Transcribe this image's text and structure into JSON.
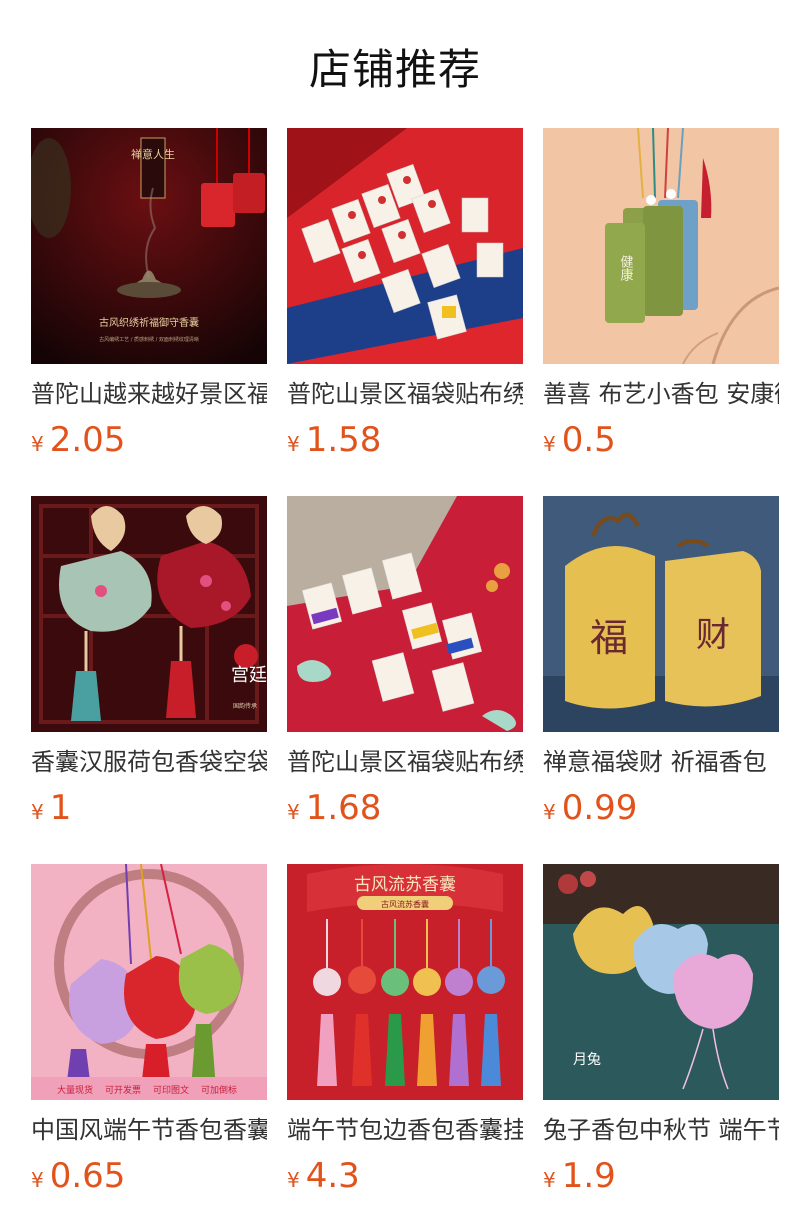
{
  "page_title": "店铺推荐",
  "products": [
    {
      "name": "普陀山越来越好景区福袋香囊祈福御守",
      "currency": "¥",
      "price": "2.05",
      "image_texts": [
        "禅意人生",
        "古风织绣祈福御守香囊",
        "古风编绣工艺 / 质感刺绣 / 双面刺绣纹理清晰"
      ]
    },
    {
      "name": "普陀山景区福袋贴布绣御守挂件",
      "currency": "¥",
      "price": "1.58",
      "image_texts": []
    },
    {
      "name": "善喜 布艺小香包 安康御守",
      "currency": "¥",
      "price": "0.5",
      "image_texts": [
        "健康"
      ]
    },
    {
      "name": "香囊汉服荷包香袋空袋挂件",
      "currency": "¥",
      "price": "1",
      "image_texts": [
        "宫廷香囊",
        "国韵传承"
      ]
    },
    {
      "name": "普陀山景区福袋贴布绣御守挂件",
      "currency": "¥",
      "price": "1.68",
      "image_texts": []
    },
    {
      "name": "禅意福袋财 祈福香包",
      "currency": "¥",
      "price": "0.99",
      "image_texts": [
        "福",
        "财"
      ]
    },
    {
      "name": "中国风端午节香包香囊挂件",
      "currency": "¥",
      "price": "0.65",
      "image_texts": [
        "大量现货",
        "可开发票",
        "可印图文",
        "可加倒标"
      ]
    },
    {
      "name": "端午节包边香包香囊挂件",
      "currency": "¥",
      "price": "4.3",
      "image_texts": [
        "古风流苏香囊",
        "古风流苏香囊"
      ]
    },
    {
      "name": "兔子香包中秋节 端午节香囊",
      "currency": "¥",
      "price": "1.9",
      "image_texts": [
        "月兔"
      ]
    }
  ]
}
